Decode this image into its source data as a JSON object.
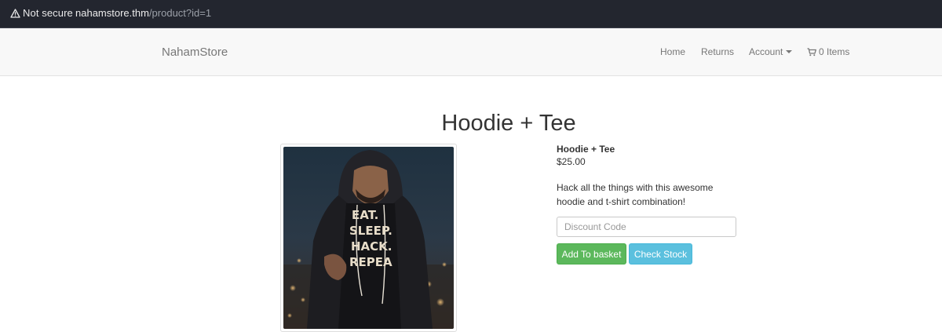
{
  "browser": {
    "security_label": "Not secure",
    "url_host": "nahamstore.thm",
    "url_path": "/product?id=1",
    "warning_icon": "warning-triangle-icon"
  },
  "navbar": {
    "brand": "NahamStore",
    "home": "Home",
    "returns": "Returns",
    "account": "Account",
    "basket": "0 Items",
    "cart_icon": "shopping-cart-icon"
  },
  "product": {
    "page_title": "Hoodie + Tee",
    "name": "Hoodie + Tee",
    "price": "$25.00",
    "description": "Hack all the things with this awesome hoodie and t-shirt combination!",
    "image_shirt_text": [
      "EAT.",
      "SLEEP.",
      "HACK.",
      "REPEA"
    ],
    "discount_placeholder": "Discount Code",
    "add_button": "Add To basket",
    "stock_button": "Check Stock"
  },
  "colors": {
    "success": "#5cb85c",
    "info": "#5bc0de",
    "browser_chrome": "#23262f"
  }
}
